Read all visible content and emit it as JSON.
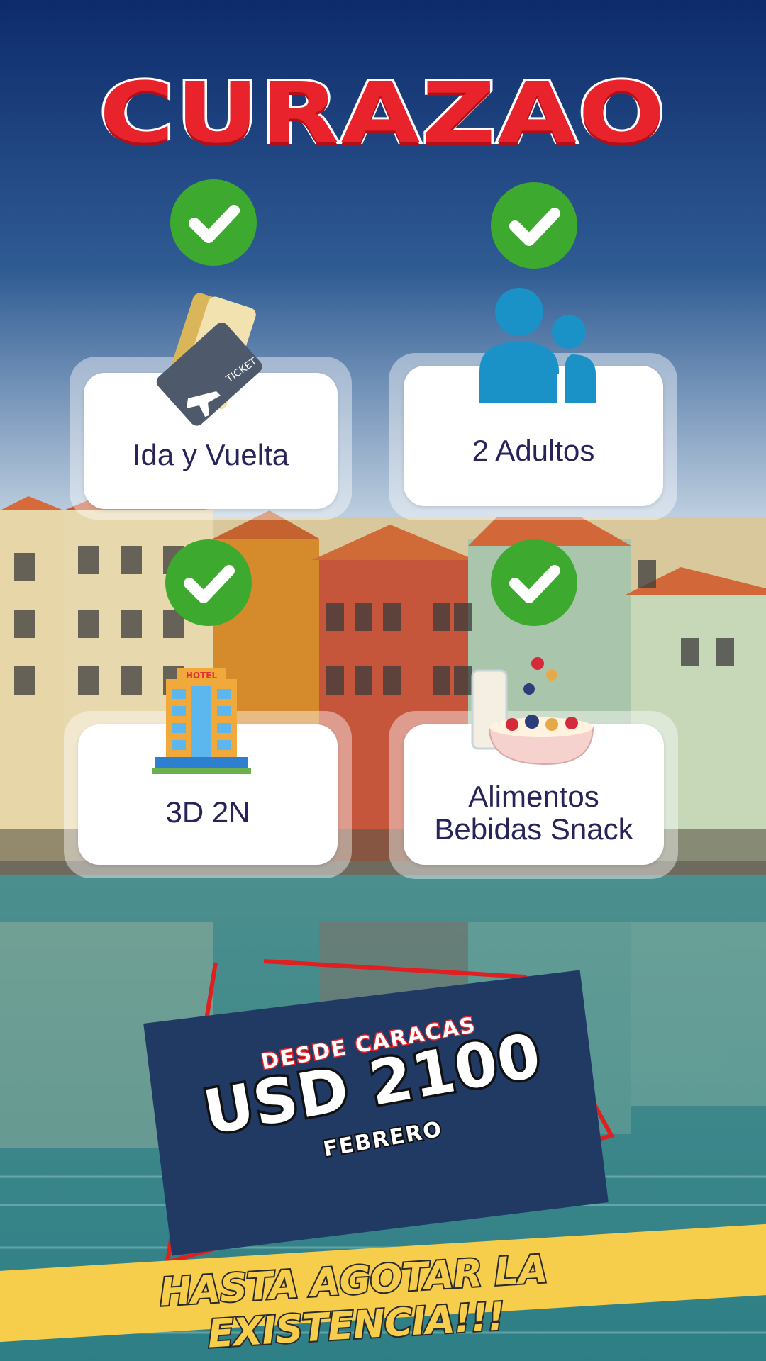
{
  "title": "CURAZAO",
  "features": [
    {
      "label": "Ida y Vuelta",
      "icon": "ticket-icon",
      "checked": true
    },
    {
      "label": "2 Adultos",
      "icon": "people-icon",
      "checked": true
    },
    {
      "label": "3D 2N",
      "icon": "hotel-icon",
      "checked": true
    },
    {
      "label_line1": "Alimentos",
      "label_line2": "Bebidas Snack",
      "icon": "breakfast-bowl-icon",
      "checked": true
    }
  ],
  "price": {
    "from_label": "DESDE CARACAS",
    "amount": "USD 2100",
    "month": "FEBRERO"
  },
  "banner": "HASTA AGOTAR LA EXISTENCIA!!!",
  "hotel_sign": "HOTEL",
  "ticket_word": "TICKET",
  "colors": {
    "title_red": "#e8232b",
    "check_green": "#3ea92f",
    "label_navy": "#27245a",
    "price_panel": "#213a63",
    "banner_yellow": "#f7cd4c",
    "people_blue": "#1b92c7"
  }
}
